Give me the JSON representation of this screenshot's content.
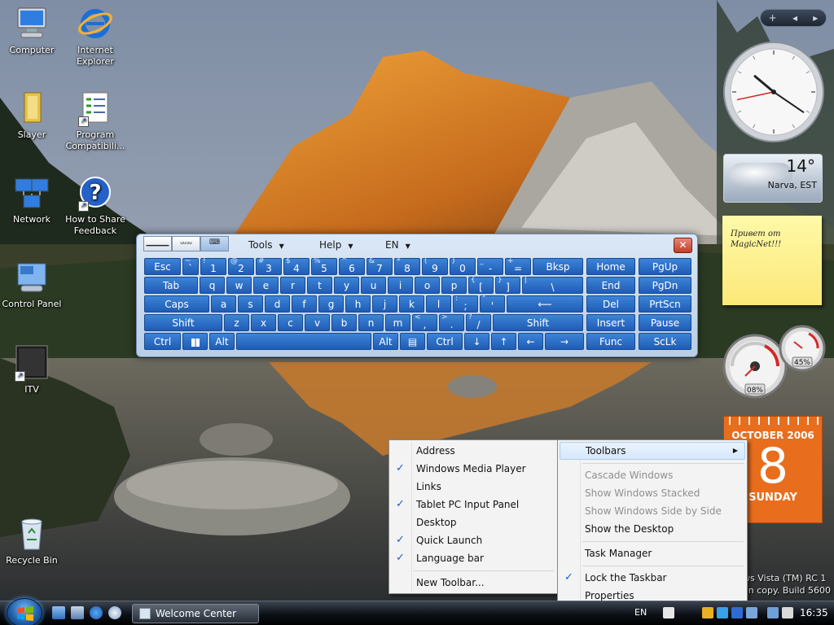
{
  "desktop": {
    "icons": [
      {
        "label": "Computer",
        "icon": "computer-icon"
      },
      {
        "label": "Internet Explorer",
        "icon": "internet-explorer-icon"
      },
      {
        "label": "Slayer",
        "icon": "folder-icon"
      },
      {
        "label": "Program Compatibili...",
        "icon": "program-compatibility-icon"
      },
      {
        "label": "Network",
        "icon": "network-icon"
      },
      {
        "label": "How to Share Feedback",
        "icon": "help-icon"
      },
      {
        "label": "Control Panel",
        "icon": "control-panel-icon"
      },
      {
        "label": "ITV",
        "icon": "tv-icon"
      },
      {
        "label": "Recycle Bin",
        "icon": "recycle-bin-icon"
      }
    ]
  },
  "sidebar": {
    "top_controls": {
      "add": "+",
      "prev": "◂",
      "next": "▸"
    },
    "clock": {
      "hour": 10,
      "minute": 20,
      "second": 43
    },
    "weather": {
      "temperature": "14°",
      "location": "Narva, EST"
    },
    "note": {
      "text": "Привет от MagicNet!!!"
    },
    "meters": {
      "cpu_label": "08%",
      "memory_label": "45%"
    },
    "calendar": {
      "month": "OCTOBER 2006",
      "day": "8",
      "weekday": "SUNDAY"
    }
  },
  "watermark": {
    "line1": "ws Vista (TM) RC 1",
    "line2": "on copy. Build 5600"
  },
  "osk": {
    "menus": {
      "tools": "Tools",
      "help": "Help",
      "lang": "EN"
    },
    "view_buttons": {
      "full": "▁▁▁▁",
      "compact": "ᵤᵤᵤᵤ",
      "keyboard": "⌨"
    },
    "close": "✕",
    "keys": {
      "row1": [
        {
          "m": "Esc"
        },
        {
          "s": "~",
          "m": "`"
        },
        {
          "s": "!",
          "m": "1"
        },
        {
          "s": "@",
          "m": "2"
        },
        {
          "s": "#",
          "m": "3"
        },
        {
          "s": "$",
          "m": "4"
        },
        {
          "s": "%",
          "m": "5"
        },
        {
          "s": "^",
          "m": "6"
        },
        {
          "s": "&",
          "m": "7"
        },
        {
          "s": "*",
          "m": "8"
        },
        {
          "s": "(",
          "m": "9"
        },
        {
          "s": ")",
          "m": "0"
        },
        {
          "s": "_",
          "m": "-"
        },
        {
          "s": "+",
          "m": "="
        },
        {
          "m": "Bksp"
        },
        {
          "m": "Home"
        },
        {
          "m": "PgUp"
        }
      ],
      "row2": [
        {
          "m": "Tab"
        },
        {
          "m": "q"
        },
        {
          "m": "w"
        },
        {
          "m": "e"
        },
        {
          "m": "r"
        },
        {
          "m": "t"
        },
        {
          "m": "y"
        },
        {
          "m": "u"
        },
        {
          "m": "i"
        },
        {
          "m": "o"
        },
        {
          "m": "p"
        },
        {
          "s": "{",
          "m": "["
        },
        {
          "s": "}",
          "m": "]"
        },
        {
          "s": "|",
          "m": "\\"
        },
        {
          "m": "End"
        },
        {
          "m": "PgDn"
        }
      ],
      "row3": [
        {
          "m": "Caps"
        },
        {
          "m": "a"
        },
        {
          "m": "s"
        },
        {
          "m": "d"
        },
        {
          "m": "f"
        },
        {
          "m": "g"
        },
        {
          "m": "h"
        },
        {
          "m": "j"
        },
        {
          "m": "k"
        },
        {
          "m": "l"
        },
        {
          "s": ":",
          "m": ";"
        },
        {
          "s": "\"",
          "m": "'"
        },
        {
          "m": "⟵"
        },
        {
          "m": "Del"
        },
        {
          "m": "PrtScn"
        }
      ],
      "row4": [
        {
          "m": "Shift"
        },
        {
          "m": "z"
        },
        {
          "m": "x"
        },
        {
          "m": "c"
        },
        {
          "m": "v"
        },
        {
          "m": "b"
        },
        {
          "m": "n"
        },
        {
          "m": "m"
        },
        {
          "s": "<",
          "m": ","
        },
        {
          "s": ">",
          "m": "."
        },
        {
          "s": "?",
          "m": "/"
        },
        {
          "m": "Shift"
        },
        {
          "m": "Insert"
        },
        {
          "m": "Pause"
        }
      ],
      "row5": [
        {
          "m": "Ctrl"
        },
        {
          "m": ""
        },
        {
          "m": "Alt"
        },
        {
          "m": ""
        },
        {
          "m": "Alt"
        },
        {
          "m": "▤"
        },
        {
          "m": "Ctrl"
        },
        {
          "m": "↓"
        },
        {
          "m": "↑"
        },
        {
          "m": "←"
        },
        {
          "m": "→"
        },
        {
          "m": "Func"
        },
        {
          "m": "ScLk"
        }
      ]
    }
  },
  "toolbars_menu": {
    "items": [
      {
        "label": "Address",
        "checked": false
      },
      {
        "label": "Windows Media Player",
        "checked": true
      },
      {
        "label": "Links",
        "checked": false
      },
      {
        "label": "Tablet PC Input Panel",
        "checked": true
      },
      {
        "label": "Desktop",
        "checked": false
      },
      {
        "label": "Quick Launch",
        "checked": true
      },
      {
        "label": "Language bar",
        "checked": true
      },
      {
        "label": "New Toolbar...",
        "checked": false
      }
    ],
    "check": "✓"
  },
  "taskbar_menu": {
    "toolbars": "Toolbars",
    "cascade": "Cascade Windows",
    "stacked": "Show Windows Stacked",
    "side_by_side": "Show Windows Side by Side",
    "show_desktop": "Show the Desktop",
    "task_manager": "Task Manager",
    "lock": "Lock the Taskbar",
    "properties": "Properties",
    "check": "✓",
    "arrow": "▶"
  },
  "taskbar": {
    "window_button": "Welcome Center",
    "language": "EN",
    "clock": "16:35"
  },
  "colors": {
    "accent": "#1f5cb5",
    "calendar": "#e86e1d"
  }
}
